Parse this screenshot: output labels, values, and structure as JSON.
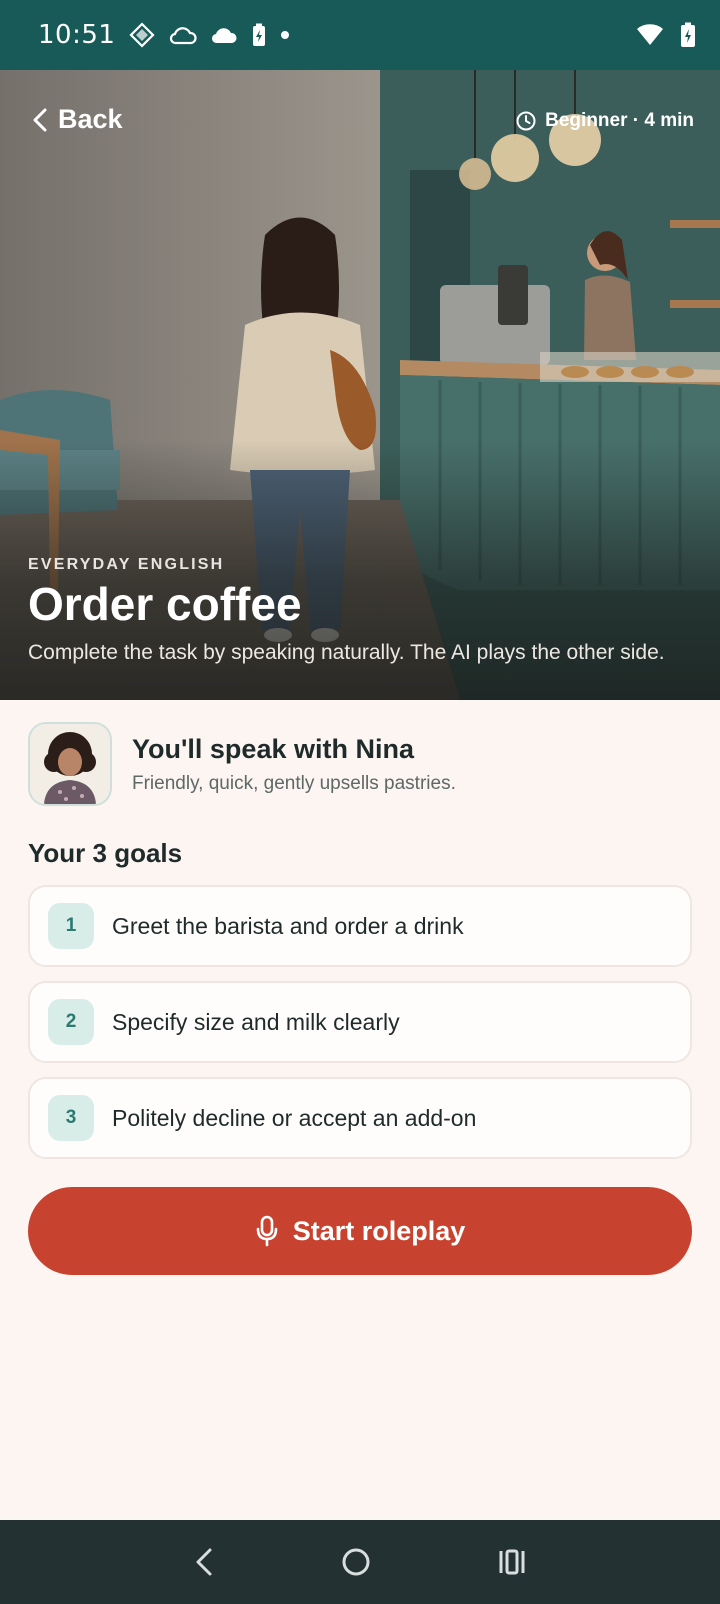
{
  "status_bar": {
    "time": "10:51",
    "left_icons": [
      "signal-diamond-icon",
      "cloud-outline-icon",
      "cloud-icon",
      "battery-saver-icon"
    ],
    "right_icons": [
      "wifi-icon",
      "battery-charging-icon"
    ]
  },
  "header": {
    "back_label": "Back",
    "meta_label": "Beginner · 4 min"
  },
  "hero": {
    "eyebrow": "EVERYDAY ENGLISH",
    "title": "Order coffee",
    "subtitle": "Complete the task by speaking naturally. The AI plays the other side."
  },
  "partner": {
    "title": "You'll speak with Nina",
    "description": "Friendly, quick, gently upsells pastries."
  },
  "goals": {
    "title": "Your 3 goals",
    "items": [
      {
        "num": "1",
        "text": "Greet the barista and order a drink"
      },
      {
        "num": "2",
        "text": "Specify size and milk clearly"
      },
      {
        "num": "3",
        "text": "Politely decline or accept an add-on"
      }
    ]
  },
  "cta": {
    "label": "Start roleplay"
  },
  "colors": {
    "status_bar": "#175a57",
    "background": "#fdf5f2",
    "accent": "#c8432f",
    "goal_badge": "#d8ece8",
    "nav_bar": "#243133"
  }
}
